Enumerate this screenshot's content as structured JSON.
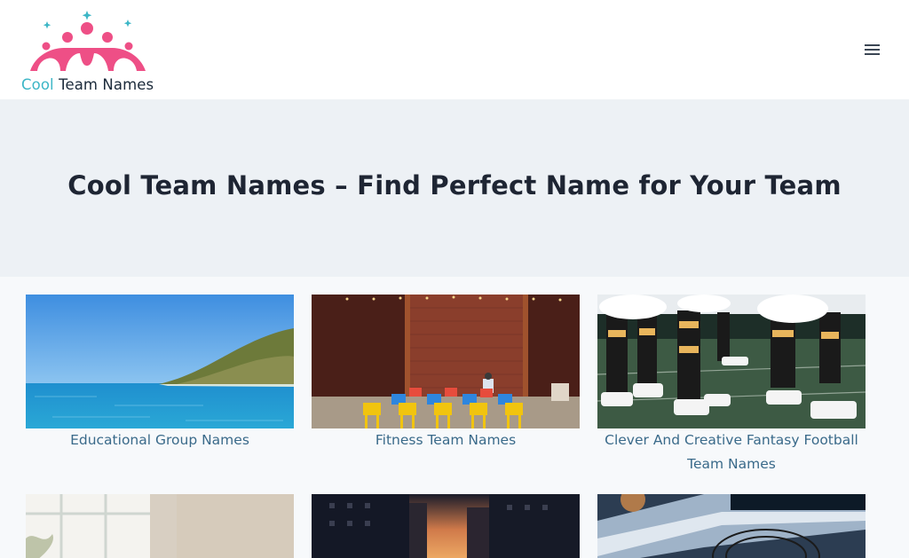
{
  "header": {
    "logo_text_1": "Cool",
    "logo_text_2": "Team Names",
    "menu_icon": "hamburger-menu-icon"
  },
  "hero": {
    "title": "Cool Team Names – Find Perfect Name for Your Team"
  },
  "posts": [
    {
      "title": "Educational Group Names",
      "image": "sea-coast-image"
    },
    {
      "title": "Fitness Team Names",
      "image": "chairs-brick-wall-image"
    },
    {
      "title": "Clever And Creative Fantasy Football Team Names",
      "image": "football-players-legs-image"
    },
    {
      "title": "",
      "image": "window-interior-image"
    },
    {
      "title": "",
      "image": "city-street-sunset-image"
    },
    {
      "title": "",
      "image": "basketball-hoop-image"
    }
  ],
  "colors": {
    "brand_pink": "#ee4f86",
    "brand_teal": "#3cb6c6",
    "link": "#3a6a8a",
    "hero_bg": "#edf1f5"
  }
}
